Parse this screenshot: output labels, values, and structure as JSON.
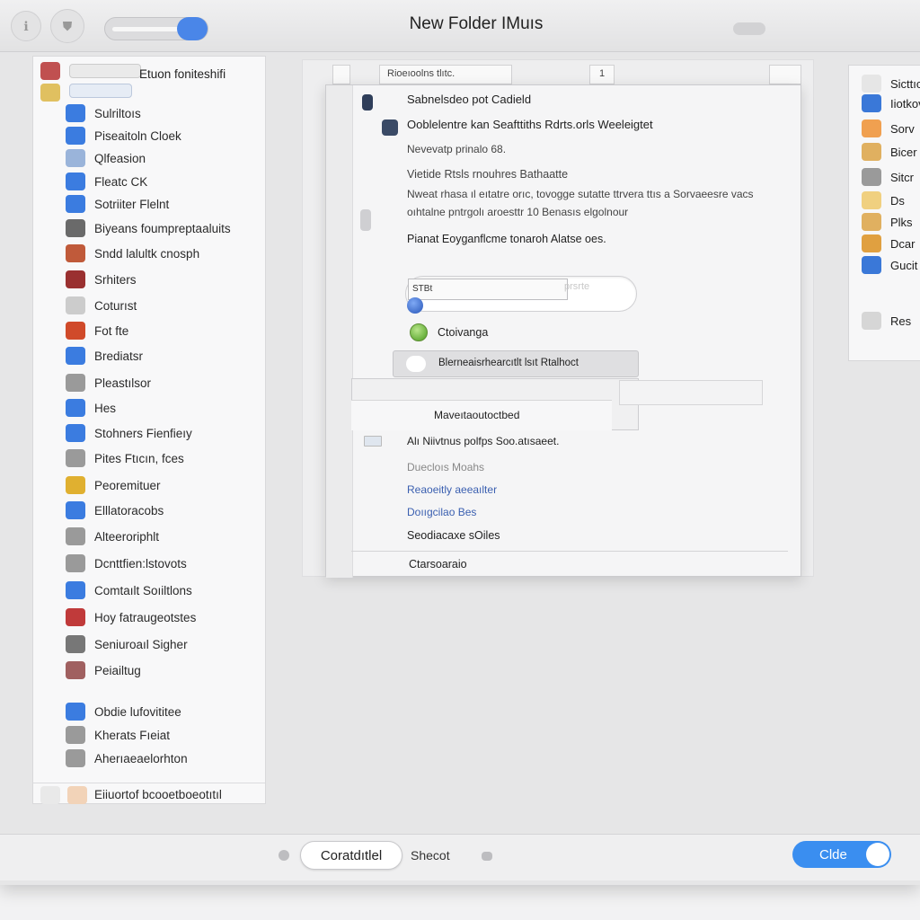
{
  "window": {
    "title": "New Folder IMuıs"
  },
  "sidebar": {
    "header": "Etuon foniteshifi",
    "items": [
      {
        "label": "Sulriltoıs",
        "icon": "image-icon",
        "color": "#3b7ce0"
      },
      {
        "label": "Piseaitoln Cloek",
        "icon": "document-icon",
        "color": "#3b7ce0"
      },
      {
        "label": "Qlfeasion",
        "icon": "keyboard-icon",
        "color": "#9ab4da"
      },
      {
        "label": "Fleatc CK",
        "icon": "app-icon",
        "color": "#3b7ce0"
      },
      {
        "label": "Sotriiter Flelnt",
        "icon": "drop-icon",
        "color": "#3b7ce0"
      },
      {
        "label": "Biyeans foumpreptaaluits",
        "icon": "drive-icon",
        "color": "#6a6a6a"
      },
      {
        "label": "Sndd lalultk cnosph",
        "icon": "paint-icon",
        "color": "#c05a3a"
      },
      {
        "label": "Srhiters",
        "icon": "book-icon",
        "color": "#9a3030"
      },
      {
        "label": "Coturıst",
        "icon": "blank-icon",
        "color": "#cccccc"
      },
      {
        "label": "Fot fte",
        "icon": "play-icon",
        "color": "#d04a2a"
      },
      {
        "label": "Brediatsr",
        "icon": "link-icon",
        "color": "#3b7ce0"
      },
      {
        "label": "Pleastılsor",
        "icon": "grid-icon",
        "color": "#9a9a9a"
      },
      {
        "label": "Hes",
        "icon": "mail-icon",
        "color": "#3b7ce0"
      },
      {
        "label": "Stohners Fienfieıy",
        "icon": "globe-icon",
        "color": "#3b7ce0"
      },
      {
        "label": "Pites Ftıcın, fces",
        "icon": "list-icon",
        "color": "#9a9a9a"
      },
      {
        "label": "Peoremituer",
        "icon": "folder-icon",
        "color": "#e0b030"
      },
      {
        "label": "Elllatoracobs",
        "icon": "window-icon",
        "color": "#3b7ce0"
      },
      {
        "label": "Alteeroriphlt",
        "icon": "doc-icon",
        "color": "#9a9a9a"
      },
      {
        "label": "Dcnttfien:lstovots",
        "icon": "doc-icon",
        "color": "#9a9a9a"
      },
      {
        "label": "Comtaılt Soıiltlons",
        "icon": "calendar-icon",
        "color": "#3b7ce0"
      },
      {
        "label": "Hoy fatraugeotstes",
        "icon": "heart-icon",
        "color": "#c03a3a"
      },
      {
        "label": "Seniuroaıl Sigher",
        "icon": "square-icon",
        "color": "#777777"
      },
      {
        "label": "Peiailtug",
        "icon": "circle-icon",
        "color": "#a06060"
      },
      {
        "label": "Obdie lufovititee",
        "icon": "arrow-icon",
        "color": "#3b7ce0"
      },
      {
        "label": "Kherats Fıeiat",
        "icon": "image-icon",
        "color": "#9a9a9a"
      },
      {
        "label": "Aherıaeaelorhton",
        "icon": "camera-icon",
        "color": "#9a9a9a"
      }
    ],
    "footer": "Eiiuortof bcooetboeotıtıl"
  },
  "background": {
    "tab1": "Rioeıoolns tlıtc.",
    "tab2": "1"
  },
  "dialog": {
    "line1": "Sabnelsdeo pot Cadield",
    "line2": "Ooblelentre kan Seafttiths Rdrts.orls Weeleigtet",
    "line3": "Nevevatp prinalo 68.",
    "line4": "Vietide Rtsls rnouhres Bathaatte",
    "line5a": "Nweat rhasa ıl eıtatre orıc, tovogge sutatte ttrvera ttıs a Sorvaeesre vacs",
    "line5b": "oıhtalne pntrgolı aroesttr 10 Benasıs elgolnour",
    "line6": "Pianat Eoyganflcme tonaroh Alatse oes.",
    "field_value": "STBt",
    "field_hint": "prsrte",
    "radio_label": "Ctoivanga",
    "dropdown_label": "Blerneaisrhearcıtlt lsıt Rtalhoct",
    "menu_item": "Maveıtaoutoctbed",
    "row1": "Alı Niivtnus polfps Soo.atısaeet.",
    "row2": "Duecloıs Moahs",
    "row3": "Reaoeitly aeeaılter",
    "row4": "Doııgcilao Bes",
    "row5": "Seodiacaxe sOiles",
    "row6": "Ctarsoaraio"
  },
  "right_panel": {
    "items": [
      {
        "label": "Sicttıcaos",
        "icon": "tv-icon"
      },
      {
        "label": "Iiotkovi",
        "icon": "toggle-icon"
      },
      {
        "label": "Sorv",
        "icon": "pin-icon"
      },
      {
        "label": "Bicer",
        "icon": "note-icon"
      },
      {
        "label": "Sitcr",
        "icon": "lines-icon"
      },
      {
        "label": "Ds",
        "icon": "folder-icon"
      },
      {
        "label": "Plks",
        "icon": "pencil-icon"
      },
      {
        "label": "Dcar",
        "icon": "box-icon"
      },
      {
        "label": "Gucit",
        "icon": "window-icon"
      },
      {
        "label": "Res",
        "icon": "page-icon"
      }
    ]
  },
  "bottom": {
    "cancel": "Coratdıtlel",
    "secondary": "Shecot",
    "primary": "Clde"
  }
}
